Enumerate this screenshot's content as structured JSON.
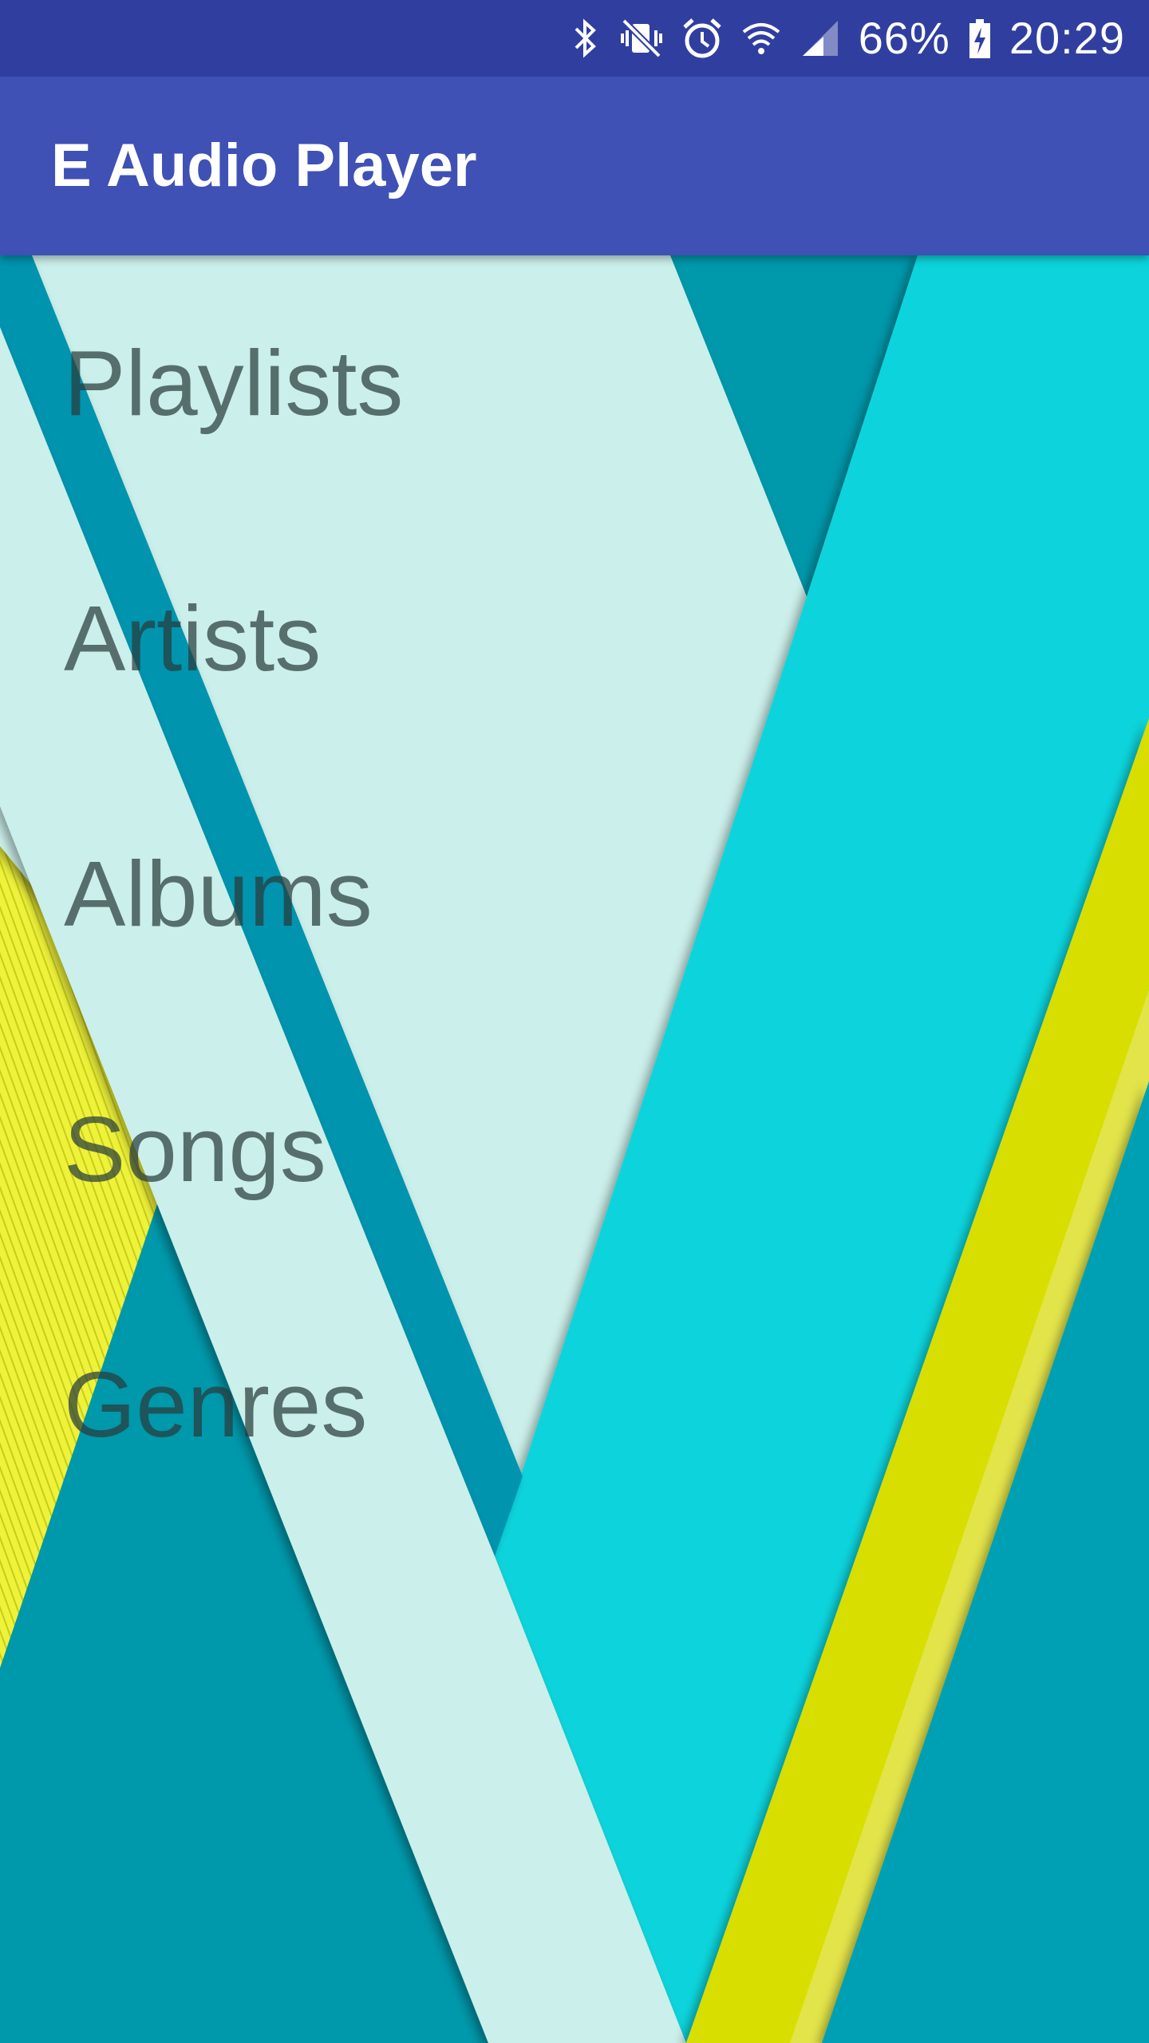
{
  "status_bar": {
    "battery_level": "66%",
    "time": "20:29",
    "icons": [
      "bluetooth-icon",
      "vibrate-mute-icon",
      "alarm-icon",
      "wifi-icon",
      "cell-signal-icon",
      "battery-charging-icon"
    ]
  },
  "app_bar": {
    "title": "E Audio Player"
  },
  "menu": {
    "items": [
      {
        "label": "Playlists"
      },
      {
        "label": "Artists"
      },
      {
        "label": "Albums"
      },
      {
        "label": "Songs"
      },
      {
        "label": "Genres"
      }
    ]
  },
  "colors": {
    "status_bar": "#303f9f",
    "app_bar": "#3f51b5",
    "wallpaper_teal": "#0098ab",
    "wallpaper_cyan": "#10d4dc",
    "wallpaper_mint": "#cbefea",
    "wallpaper_yellow": "#d8de06",
    "menu_text": "#3c4c4c"
  }
}
